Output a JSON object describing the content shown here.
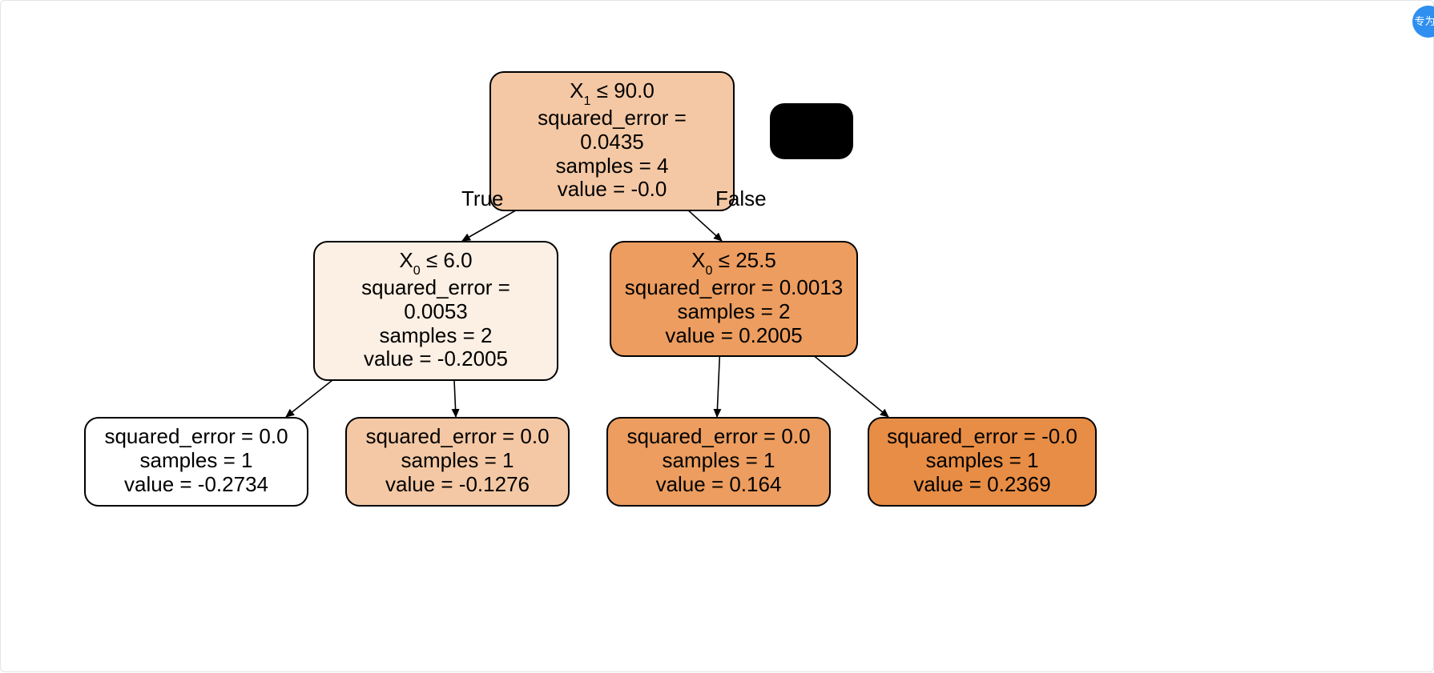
{
  "colors": {
    "root": "#f4c8a4",
    "left": "#fcefe3",
    "right": "#ec9d5f",
    "ll": "#ffffff",
    "lr": "#f4c8a4",
    "rl": "#ec9d5f",
    "rr": "#e88d45"
  },
  "branch": {
    "true": "True",
    "false": "False"
  },
  "nodes": {
    "root": {
      "cond_var": "X",
      "cond_sub": "1",
      "cond_op_val": " ≤ 90.0",
      "err": "squared_error = 0.0435",
      "samples": "samples = 4",
      "value": "value = -0.0"
    },
    "left": {
      "cond_var": "X",
      "cond_sub": "0",
      "cond_op_val": " ≤ 6.0",
      "err": "squared_error = 0.0053",
      "samples": "samples = 2",
      "value": "value = -0.2005"
    },
    "right": {
      "cond_var": "X",
      "cond_sub": "0",
      "cond_op_val": " ≤ 25.5",
      "err": "squared_error = 0.0013",
      "samples": "samples = 2",
      "value": "value = 0.2005"
    },
    "ll": {
      "err": "squared_error = 0.0",
      "samples": "samples = 1",
      "value": "value = -0.2734"
    },
    "lr": {
      "err": "squared_error = 0.0",
      "samples": "samples = 1",
      "value": "value = -0.1276"
    },
    "rl": {
      "err": "squared_error = 0.0",
      "samples": "samples = 1",
      "value": "value = 0.164"
    },
    "rr": {
      "err": "squared_error = -0.0",
      "samples": "samples = 1",
      "value": "value = 0.2369"
    }
  },
  "watermark": "专为V"
}
